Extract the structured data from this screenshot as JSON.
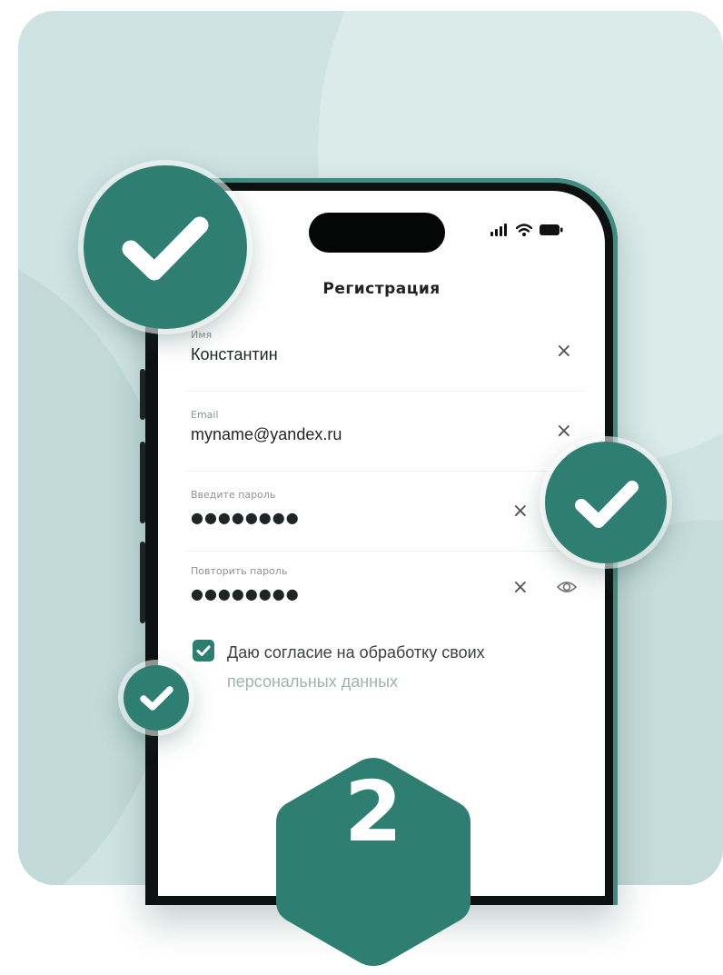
{
  "screen": {
    "title": "Регистрация"
  },
  "fields": [
    {
      "label": "Имя",
      "value": "Константин",
      "clear_icon": "close-icon"
    },
    {
      "label": "Email",
      "value": "myname@yandex.ru",
      "clear_icon": "close-icon"
    },
    {
      "label": "Введите пароль",
      "value": "●●●●●●●●",
      "clear_icon": "close-icon"
    },
    {
      "label": "Повторить пароль",
      "value": "●●●●●●●●",
      "clear_icon": "close-icon",
      "toggle_icon": "eye-icon"
    }
  ],
  "consent": {
    "checked": true,
    "line1": "Даю согласие на обработку своих",
    "line2": "персональных данных"
  },
  "step": {
    "number": "2"
  },
  "icons": {
    "status": [
      "signal-icon",
      "wifi-icon",
      "battery-icon"
    ],
    "badge": "check-icon"
  },
  "colors": {
    "accent": "#2e7f72",
    "card_background": "#cfe3e2",
    "phone_body": "#0e1111"
  }
}
